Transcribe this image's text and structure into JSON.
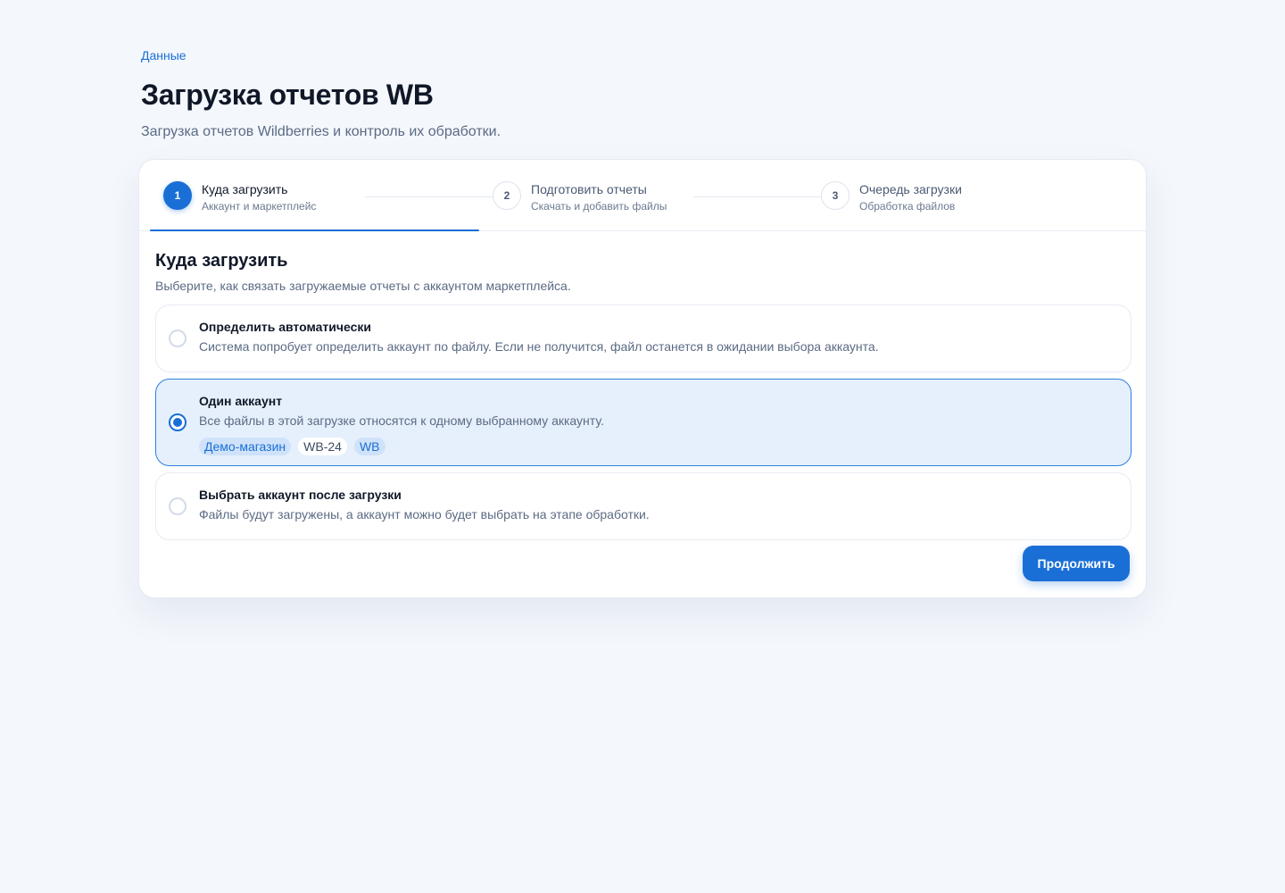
{
  "breadcrumb": "Данные",
  "page": {
    "title": "Загрузка отчетов WB",
    "subtitle": "Загрузка отчетов Wildberries и контроль их обработки."
  },
  "steps": [
    {
      "number": "1",
      "title": "Куда загрузить",
      "subtitle": "Аккаунт и маркетплейс",
      "active": true
    },
    {
      "number": "2",
      "title": "Подготовить отчеты",
      "subtitle": "Скачать и добавить файлы",
      "active": false
    },
    {
      "number": "3",
      "title": "Очередь загрузки",
      "subtitle": "Обработка файлов",
      "active": false
    }
  ],
  "section": {
    "title": "Куда загрузить",
    "description": "Выберите, как связать загружаемые отчеты с аккаунтом маркетплейса."
  },
  "options": [
    {
      "title": "Определить автоматически",
      "description": "Система попробует определить аккаунт по файлу. Если не получится, файл останется в ожидании выбора аккаунта.",
      "selected": false
    },
    {
      "title": "Один аккаунт",
      "description": "Все файлы в этой загрузке относятся к одному выбранному аккаунту.",
      "selected": true,
      "chips": [
        "Демо-магазин",
        "WB-24",
        "WB"
      ]
    },
    {
      "title": "Выбрать аккаунт после загрузки",
      "description": "Файлы будут загружены, а аккаунт можно будет выбрать на этапе обработки.",
      "selected": false
    }
  ],
  "actions": {
    "continue_label": "Продолжить"
  },
  "colors": {
    "accent": "#1a6fd6",
    "background": "#f4f7fc",
    "selected_bg": "#e6f0fc"
  }
}
